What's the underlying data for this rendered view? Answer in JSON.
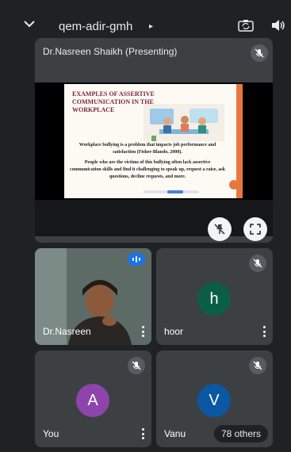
{
  "header": {
    "meeting_code": "qem-adir-gmh",
    "caret_glyph": "▸",
    "icons": [
      "chevron-down-icon",
      "switch-camera-icon",
      "speaker-icon"
    ]
  },
  "presentation": {
    "presenter_label": "Dr.Nasreen Shaikh (Presenting)",
    "slide": {
      "title": "EXAMPLES OF ASSERTIVE COMMUNICATION IN THE WORKPLACE",
      "paragraph_1": "Workplace bullying is a problem that impacts job performance and satisfaction (Fisher-Blando, 2008).",
      "paragraph_2": "People who are the victims of this bullying often lack assertive communication skills and find it challenging to speak up, request a raise, ask questions, decline requests, and more.",
      "accent_color": "#e8773f"
    },
    "icons": [
      "mic-off-icon",
      "unpin-icon",
      "fullscreen-icon"
    ]
  },
  "participants": [
    {
      "name": "Dr.Nasreen",
      "type": "video",
      "speaking": true
    },
    {
      "name": "hoor",
      "initial": "h",
      "avatar_color": "#0b5e46",
      "muted": true
    },
    {
      "name": "You",
      "initial": "A",
      "avatar_color": "#8e44ad",
      "muted": true
    },
    {
      "name": "Vanu",
      "initial": "V",
      "avatar_color": "#0b57a4",
      "muted": true
    }
  ],
  "others_label": "78 others",
  "colors": {
    "background": "#202124",
    "tile": "#3c4043",
    "speaking": "#1a73e8"
  }
}
